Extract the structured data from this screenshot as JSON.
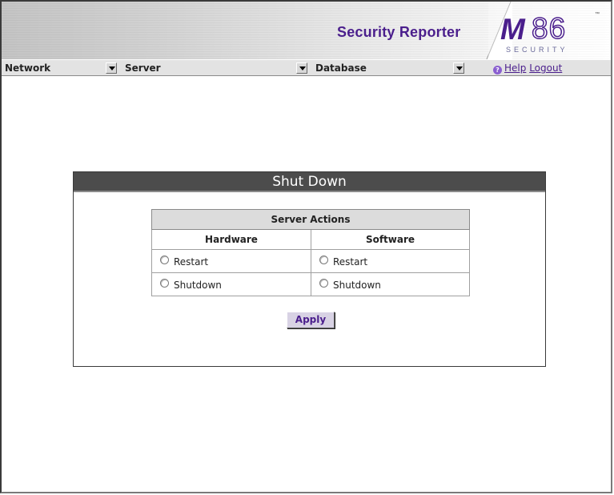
{
  "header": {
    "app_title": "Security Reporter",
    "logo": {
      "mark": "M",
      "number": "86",
      "tagline": "SECURITY",
      "tm": "™"
    }
  },
  "navbar": {
    "menus": [
      {
        "label": "Network",
        "icon": "chevron-down-icon"
      },
      {
        "label": "Server",
        "icon": "chevron-down-icon"
      },
      {
        "label": "Database",
        "icon": "chevron-down-icon"
      }
    ],
    "help": {
      "icon": "help-icon",
      "label": "Help"
    },
    "logout": {
      "label": "Logout"
    }
  },
  "shutdown_panel": {
    "title": "Shut Down",
    "table": {
      "caption": "Server Actions",
      "columns": [
        "Hardware",
        "Software"
      ],
      "rows": [
        [
          "Restart",
          "Restart"
        ],
        [
          "Shutdown",
          "Shutdown"
        ]
      ]
    },
    "apply_label": "Apply"
  },
  "colors": {
    "brand": "#4a1e8c",
    "panel_title_bg": "#4c4c4c",
    "navbar_bg": "#e3e3e3",
    "table_caption_bg": "#dcdcdc",
    "apply_bg": "#d8d2e4"
  }
}
